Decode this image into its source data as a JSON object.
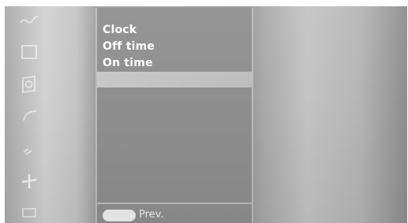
{
  "menu": {
    "items": [
      {
        "label": "Clock"
      },
      {
        "label": "Off time"
      },
      {
        "label": "On time"
      },
      {
        "label": ""
      }
    ],
    "selected_index": 3
  },
  "footer": {
    "prev_label": "Prev."
  },
  "side_icons": [
    {
      "name": "wave-icon"
    },
    {
      "name": "screen-icon"
    },
    {
      "name": "speaker-icon"
    },
    {
      "name": "curve-icon"
    },
    {
      "name": "signal-icon"
    },
    {
      "name": "plus-icon"
    },
    {
      "name": "box-icon"
    }
  ],
  "colors": {
    "panel": "#8f8f8f",
    "text": "#ffffff",
    "selection": "#c4c4c4",
    "key": "#efefef"
  }
}
